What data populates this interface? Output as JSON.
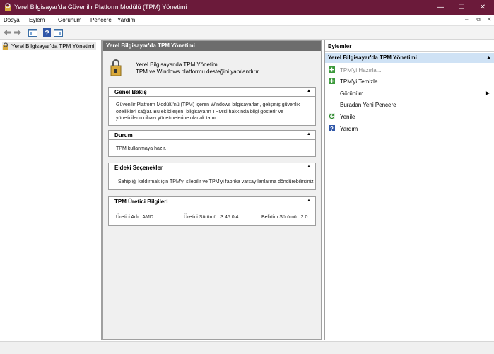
{
  "window": {
    "title": "Yerel Bilgisayar'da Güvenilir Platform Modülü (TPM) Yönetimi"
  },
  "menu": {
    "items": [
      "Dosya",
      "Eylem",
      "Görünüm",
      "Pencere",
      "Yardım"
    ]
  },
  "tree": {
    "root": "Yerel Bilgisayar'da TPM Yönetimi"
  },
  "center": {
    "header": "Yerel Bilgisayar'da TPM Yönetimi",
    "intro_line1": "Yerel Bilgisayar'da TPM Yönetimi",
    "intro_line2": "TPM ve Windows platformu desteğini yapılandırır",
    "overview": {
      "title": "Genel Bakış",
      "line1": "Güvenilir Platform Modülü'nü (TPM) içeren Windows bilgisayarları, gelişmiş güvenlik",
      "line2": "özellikleri sağlar. Bu ek bileşen, bilgisayarın TPM'si hakkında bilgi gösterir ve",
      "line3": "yöneticilerin cihazı yönetmelerine olanak tanır."
    },
    "status": {
      "title": "Durum",
      "text": "TPM kullanmaya hazır."
    },
    "options": {
      "title": "Eldeki Seçenekler",
      "text": "Sahipliği kaldırmak için TPM'yi silebilir ve TPM'yi fabrika varsayılanlarına döndürebilirsiniz."
    },
    "manufacturer": {
      "title": "TPM Üretici Bilgileri",
      "name_label": "Üretici Adı:",
      "name_value": "AMD",
      "version_label": "Üretici Sürümü:",
      "version_value": "3.45.0.4",
      "spec_label": "Belirtim Sürümü:",
      "spec_value": "2.0"
    }
  },
  "actions": {
    "header": "Eylemler",
    "group": "Yerel Bilgisayar'da TPM Yönetimi",
    "items": [
      "TPM'yi Hazırla...",
      "TPM'yi Temizle...",
      "Görünüm",
      "Buradan Yeni Pencere",
      "Yenile",
      "Yardım"
    ]
  },
  "colors": {
    "titlebar": "#6b1a3a",
    "selection": "#cfe2f5",
    "header_gray": "#6d6d6d"
  }
}
